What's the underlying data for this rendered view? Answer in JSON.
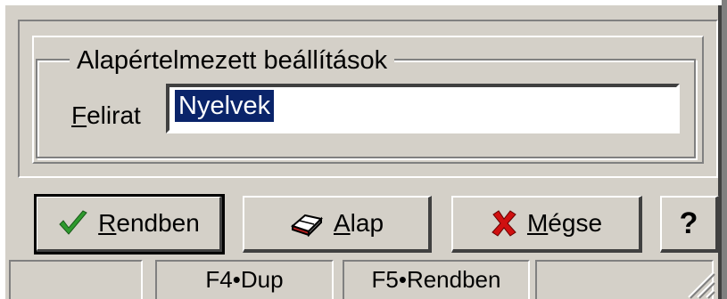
{
  "group": {
    "title": "Alapértelmezett beállítások"
  },
  "field": {
    "label_prefix": "F",
    "label_rest": "elirat",
    "value": "Nyelvek"
  },
  "buttons": {
    "ok": {
      "mnemonic": "R",
      "rest": "endben"
    },
    "alap": {
      "mnemonic": "A",
      "rest": "lap"
    },
    "megse": {
      "mnemonic": "M",
      "rest": "égse"
    },
    "help": "?"
  },
  "status": {
    "cells": [
      "",
      "F4•Dup",
      "F5•Rendben",
      ""
    ]
  },
  "colors": {
    "face": "#d4d0c8",
    "selection": "#0a246a",
    "check": "#2e9a2e",
    "cross": "#d01010"
  },
  "icons": [
    "checkmark-icon",
    "eraser-icon",
    "cross-icon",
    "resize-grip-icon"
  ]
}
